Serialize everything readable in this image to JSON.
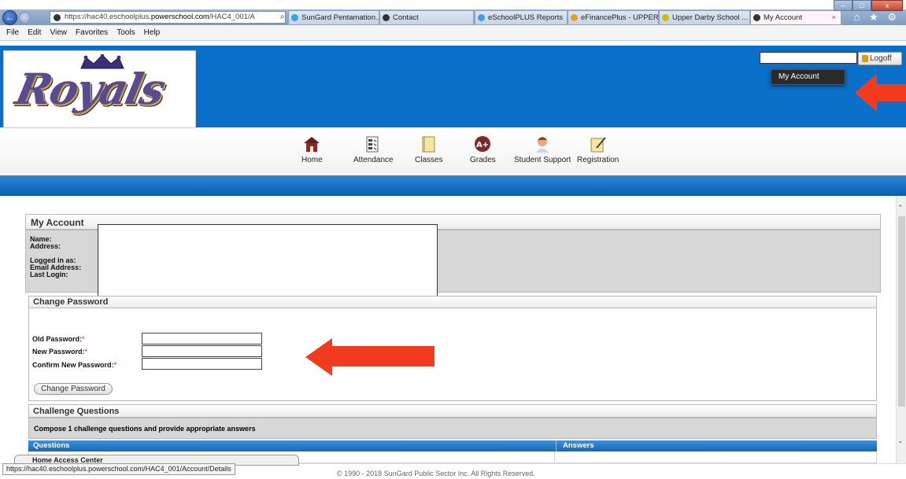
{
  "browser": {
    "url_prefix": "https://hac40.eschoolplus.",
    "url_domain": "powerschool.com",
    "url_path": "/HAC4_001/A",
    "addr_icons": "⌕ ▾ ▣ ↻",
    "tabs": [
      {
        "label": "SunGard Pentamation..."
      },
      {
        "label": "Contact"
      },
      {
        "label": "eSchoolPLUS Reports"
      },
      {
        "label": "eFinancePlus - UPPER ..."
      },
      {
        "label": "Upper Darby School ..."
      },
      {
        "label": "My Account",
        "close": "×"
      }
    ],
    "menu": [
      "File",
      "Edit",
      "View",
      "Favorites",
      "Tools",
      "Help"
    ],
    "window_controls": [
      "–",
      "□",
      "x"
    ],
    "toolbar_icons": "⌂ ★ ⚙",
    "status_url": "https://hac40.eschoolplus.powerschool.com/HAC4_001/Account/Details"
  },
  "header": {
    "logo_text": "Royals",
    "logoff_label": "Logoff",
    "dropdown_item": "My Account"
  },
  "nav": [
    {
      "label": "Home"
    },
    {
      "label": "Attendance"
    },
    {
      "label": "Classes"
    },
    {
      "label": "Grades"
    },
    {
      "label": "Student Support"
    },
    {
      "label": "Registration"
    }
  ],
  "account": {
    "title": "My Account",
    "labels": [
      "Name:",
      "Address:",
      "",
      "Logged in as:",
      "Email Address:",
      "Last Login:"
    ]
  },
  "change_password": {
    "title": "Change Password",
    "old_label": "Old Password:",
    "new_label": "New Password:",
    "confirm_label": "Confirm New Password:",
    "required_mark": "*",
    "button": "Change Password"
  },
  "challenge": {
    "title": "Challenge Questions",
    "instructions": "Compose 1 challenge questions and provide appropriate answers",
    "col_questions": "Questions",
    "col_answers": "Answers"
  },
  "footer": {
    "copyright": "© 1990 - 2018 SunGard Public Sector Inc. All Rights Reserved.",
    "hac_tab": "Home Access Center"
  },
  "colors": {
    "banner_blue": "#0a6fc9",
    "arrow_red": "#f23a1e"
  }
}
